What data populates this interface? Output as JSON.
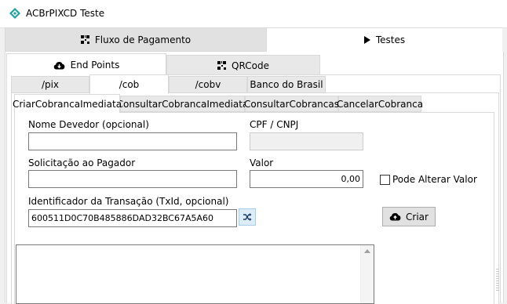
{
  "window": {
    "title": "ACBrPIXCD Teste"
  },
  "main_tabs": [
    {
      "label": "Fluxo de Pagamento",
      "icon": "qr-icon"
    },
    {
      "label": "Testes",
      "icon": "play-icon"
    }
  ],
  "sub_tabs": [
    {
      "label": "End Points",
      "icon": "cloud-download-icon"
    },
    {
      "label": "QRCode",
      "icon": "qr-icon"
    }
  ],
  "endpoint_tabs": [
    "/pix",
    "/cob",
    "/cobv",
    "Banco do Brasil"
  ],
  "operation_tabs": [
    "CriarCobrancaImediata",
    "ConsultarCobrancaImediata",
    "ConsultarCobrancas",
    "CancelarCobranca"
  ],
  "form": {
    "nome_devedor_label": "Nome Devedor (opcional)",
    "nome_devedor_value": "",
    "cpf_cnpj_label": "CPF / CNPJ",
    "cpf_cnpj_value": "",
    "solicitacao_label": "Solicitação ao Pagador",
    "solicitacao_value": "",
    "valor_label": "Valor",
    "valor_value": "0,00",
    "pode_alterar_label": "Pode Alterar Valor",
    "pode_alterar_checked": false,
    "txid_label": "Identificador da Transação (TxId, opcional)",
    "txid_value": "600511D0C70B485886DAD32BC67A5A60",
    "criar_button": "Criar"
  },
  "colors": {
    "accent": "#1fa3a0",
    "tab_inactive": "#e8e8e8",
    "border": "#d9d9d9"
  }
}
